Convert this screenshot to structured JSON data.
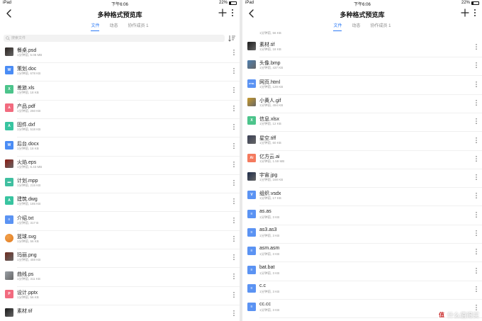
{
  "status": {
    "device": "iPad",
    "time": "下午6:06",
    "battery": "22%",
    "battery_level": 0.22
  },
  "header": {
    "title": "多种格式预览库"
  },
  "tabs": [
    {
      "label": "文件",
      "active": true
    },
    {
      "label": "动态",
      "active": false
    },
    {
      "label": "协作成员 1",
      "active": false
    }
  ],
  "search": {
    "placeholder": "搜索文件"
  },
  "colors": {
    "accent": "#2d7bf6",
    "word": "#4a8cf5",
    "excel": "#4cc48b",
    "pdf": "#f26b7f",
    "cad": "#38c4a0",
    "project": "#3fbfa0",
    "text": "#5b93f3",
    "ai": "#f47a5e"
  },
  "left_list": [
    {
      "name": "餐桌.psd",
      "meta": "1分钟前, 5.08 MB",
      "icon": "image-thumbnail-icon",
      "type": "thumb",
      "bg": "#2b2320"
    },
    {
      "name": "策划.doc",
      "meta": "1分钟前, 678 KB",
      "icon": "word-file-icon",
      "type": "tile",
      "glyph": "W",
      "bg": "#4a8cf5"
    },
    {
      "name": "差旅.xls",
      "meta": "1分钟前, 18 KB",
      "icon": "excel-file-icon",
      "type": "tile",
      "glyph": "X",
      "bg": "#4cc48b"
    },
    {
      "name": "产品.pdf",
      "meta": "1分钟前, 250 KB",
      "icon": "pdf-file-icon",
      "type": "tile",
      "glyph": "⅄",
      "bg": "#f26b7f"
    },
    {
      "name": "固件.dxf",
      "meta": "1分钟前, 518 KB",
      "icon": "cad-file-icon",
      "type": "tile",
      "glyph": "A",
      "bg": "#38c4a0"
    },
    {
      "name": "后台.docx",
      "meta": "1分钟前, 18 KB",
      "icon": "word-file-icon",
      "type": "tile",
      "glyph": "W",
      "bg": "#4a8cf5"
    },
    {
      "name": "火焰.eps",
      "meta": "1分钟前, 6.43 MB",
      "icon": "image-thumbnail-icon",
      "type": "thumb",
      "bg": "#8c1a12"
    },
    {
      "name": "计划.mpp",
      "meta": "1分钟前, 215 KB",
      "icon": "project-file-icon",
      "type": "tile",
      "glyph": "▬",
      "bg": "#3fbfa0"
    },
    {
      "name": "建筑.dwg",
      "meta": "1分钟前, 185 KB",
      "icon": "cad-file-icon",
      "type": "tile",
      "glyph": "A",
      "bg": "#38c4a0"
    },
    {
      "name": "介绍.txt",
      "meta": "1分钟前, 317 B",
      "icon": "text-file-icon",
      "type": "tile",
      "glyph": "≡",
      "bg": "#5b93f3"
    },
    {
      "name": "篮球.svg",
      "meta": "1分钟前, 56 KB",
      "icon": "basketball-thumbnail-icon",
      "type": "ball",
      "bg": "#e07a1f"
    },
    {
      "name": "玛丽.png",
      "meta": "1分钟前, 459 KB",
      "icon": "image-thumbnail-icon",
      "type": "thumb",
      "bg": "#6d2a1e"
    },
    {
      "name": "曲线.ps",
      "meta": "1分钟前, 311 KB",
      "icon": "image-thumbnail-icon",
      "type": "thumb",
      "bg": "#9aa0a6"
    },
    {
      "name": "设计.pptx",
      "meta": "1分钟前, 56 KB",
      "icon": "powerpoint-file-icon",
      "type": "tile",
      "glyph": "P",
      "bg": "#f26b7f"
    },
    {
      "name": "素材.tif",
      "meta": "",
      "icon": "image-thumbnail-icon",
      "type": "thumb",
      "bg": "#1a1a1a"
    }
  ],
  "right_list_top_meta": "1分钟前, 56 KB",
  "right_list": [
    {
      "name": "素材.tif",
      "meta": "1分钟前, 18 KB",
      "icon": "image-thumbnail-icon",
      "type": "thumb",
      "bg": "#1a1a1a"
    },
    {
      "name": "头像.bmp",
      "meta": "1分钟前, 437 KB",
      "icon": "image-thumbnail-icon",
      "type": "thumb",
      "bg": "#4e7fb0"
    },
    {
      "name": "网页.html",
      "meta": "1分钟前, 128 KB",
      "icon": "html-file-icon",
      "type": "tile",
      "glyph": "HTML",
      "bg": "#5b93f3"
    },
    {
      "name": "小黄人.gif",
      "meta": "1分钟前, 494 KB",
      "icon": "image-thumbnail-icon",
      "type": "thumb",
      "bg": "#c99a2a"
    },
    {
      "name": "信息.xlsx",
      "meta": "1分钟前, 12 KB",
      "icon": "excel-file-icon",
      "type": "tile",
      "glyph": "X",
      "bg": "#4cc48b"
    },
    {
      "name": "星空.tiff",
      "meta": "1分钟前, 60 KB",
      "icon": "image-thumbnail-icon",
      "type": "thumb",
      "bg": "#3a3f55"
    },
    {
      "name": "亿方云.ai",
      "meta": "1分钟前, 1.59 MB",
      "icon": "illustrator-file-icon",
      "type": "tile",
      "glyph": "Ai",
      "bg": "#f47a5e"
    },
    {
      "name": "宇宙.jpg",
      "meta": "1分钟前, 168 KB",
      "icon": "image-thumbnail-icon",
      "type": "thumb",
      "bg": "#1c2a48"
    },
    {
      "name": "组织.vsdx",
      "meta": "1分钟前, 17 KB",
      "icon": "visio-file-icon",
      "type": "tile",
      "glyph": "V",
      "bg": "#5b93f3"
    },
    {
      "name": "as.as",
      "meta": "1分钟前, 3 KB",
      "icon": "text-file-icon",
      "type": "tile",
      "glyph": "≡",
      "bg": "#5b93f3"
    },
    {
      "name": "as3.as3",
      "meta": "1分钟前, 3 KB",
      "icon": "text-file-icon",
      "type": "tile",
      "glyph": "≡",
      "bg": "#5b93f3"
    },
    {
      "name": "asm.asm",
      "meta": "1分钟前, 3 KB",
      "icon": "text-file-icon",
      "type": "tile",
      "glyph": "≡",
      "bg": "#5b93f3"
    },
    {
      "name": "bat.bat",
      "meta": "1分钟前, 3 KB",
      "icon": "text-file-icon",
      "type": "tile",
      "glyph": "≡",
      "bg": "#5b93f3"
    },
    {
      "name": "c.c",
      "meta": "1分钟前, 3 KB",
      "icon": "text-file-icon",
      "type": "tile",
      "glyph": "≡",
      "bg": "#5b93f3"
    },
    {
      "name": "cc.cc",
      "meta": "1分钟前, 3 KB",
      "icon": "text-file-icon",
      "type": "tile",
      "glyph": "≡",
      "bg": "#5b93f3"
    }
  ],
  "watermark": {
    "text": "什么值得买",
    "icon": "zhide-logo-icon",
    "glyph": "值"
  }
}
